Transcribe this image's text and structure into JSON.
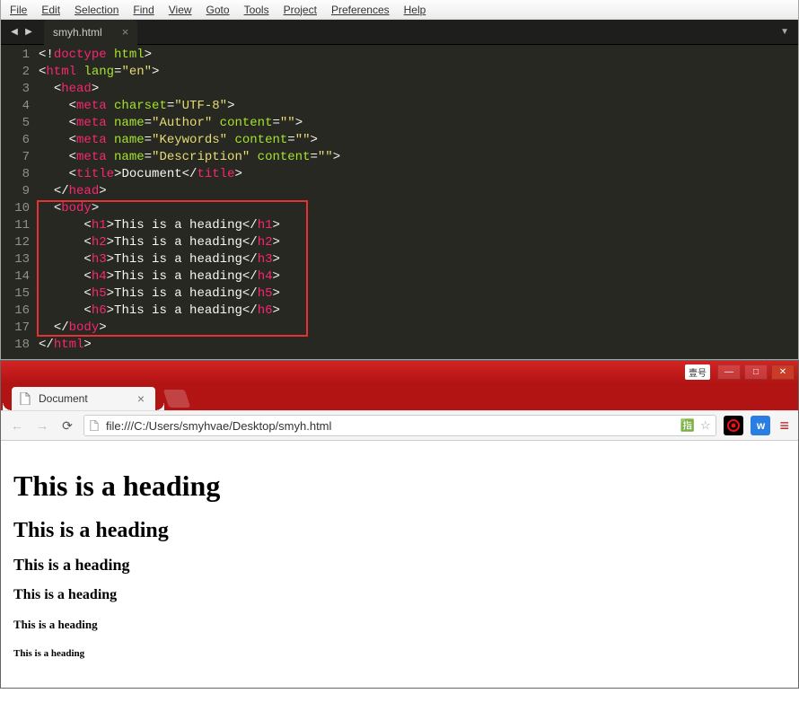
{
  "editor": {
    "menu": [
      "File",
      "Edit",
      "Selection",
      "Find",
      "View",
      "Goto",
      "Tools",
      "Project",
      "Preferences",
      "Help"
    ],
    "tab": {
      "name": "smyh.html"
    },
    "gutter": [
      "1",
      "2",
      "3",
      "4",
      "5",
      "6",
      "7",
      "8",
      "9",
      "10",
      "11",
      "12",
      "13",
      "14",
      "15",
      "16",
      "17",
      "18"
    ],
    "code": {
      "l1": {
        "p1": "<!",
        "p2": "doctype",
        "p3": " ",
        "p4": "html",
        "p5": ">"
      },
      "l2": {
        "p1": "<",
        "p2": "html",
        "p3": " ",
        "p4": "lang",
        "p5": "=",
        "p6": "\"en\"",
        "p7": ">"
      },
      "l3": {
        "indent": "  ",
        "p1": "<",
        "p2": "head",
        "p3": ">"
      },
      "l4": {
        "indent": "    ",
        "p1": "<",
        "p2": "meta",
        "p3": " ",
        "p4": "charset",
        "p5": "=",
        "p6": "\"UTF-8\"",
        "p7": ">"
      },
      "l5": {
        "indent": "    ",
        "p1": "<",
        "p2": "meta",
        "p3": " ",
        "p4": "name",
        "p5": "=",
        "p6": "\"Author\"",
        "p7": " ",
        "p8": "content",
        "p9": "=",
        "p10": "\"\"",
        "p11": ">"
      },
      "l6": {
        "indent": "    ",
        "p1": "<",
        "p2": "meta",
        "p3": " ",
        "p4": "name",
        "p5": "=",
        "p6": "\"Keywords\"",
        "p7": " ",
        "p8": "content",
        "p9": "=",
        "p10": "\"\"",
        "p11": ">"
      },
      "l7": {
        "indent": "    ",
        "p1": "<",
        "p2": "meta",
        "p3": " ",
        "p4": "name",
        "p5": "=",
        "p6": "\"Description\"",
        "p7": " ",
        "p8": "content",
        "p9": "=",
        "p10": "\"\"",
        "p11": ">"
      },
      "l8": {
        "indent": "    ",
        "p1": "<",
        "p2": "title",
        "p3": ">",
        "p4": "Document",
        "p5": "</",
        "p6": "title",
        "p7": ">"
      },
      "l9": {
        "indent": "  ",
        "p1": "</",
        "p2": "head",
        "p3": ">"
      },
      "l10": {
        "indent": "  ",
        "p1": "<",
        "p2": "body",
        "p3": ">"
      },
      "h": {
        "open_l": "<",
        "open_r": ">",
        "close_l": "</",
        "close_r": ">",
        "text": "This is a heading",
        "indent": "      "
      },
      "tags": {
        "h1": "h1",
        "h2": "h2",
        "h3": "h3",
        "h4": "h4",
        "h5": "h5",
        "h6": "h6"
      },
      "l17": {
        "indent": "  ",
        "p1": "</",
        "p2": "body",
        "p3": ">"
      },
      "l18": {
        "p1": "</",
        "p2": "html",
        "p3": ">"
      }
    }
  },
  "browser": {
    "titlebar_badge": "壹号",
    "tab_title": "Document",
    "url": "file:///C:/Users/smyhvae/Desktop/smyh.html",
    "headings": {
      "h1": "This is a heading",
      "h2": "This is a heading",
      "h3": "This is a heading",
      "h4": "This is a heading",
      "h5": "This is a heading",
      "h6": "This is a heading"
    },
    "ext_w_label": "w"
  }
}
